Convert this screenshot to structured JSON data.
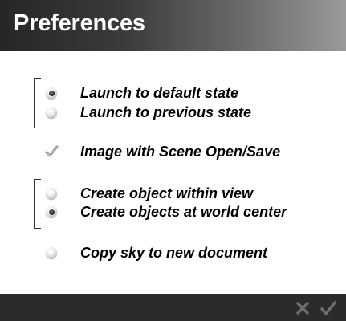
{
  "header": {
    "title": "Preferences"
  },
  "launch_group": {
    "options": [
      {
        "label": "Launch to default state",
        "selected": true
      },
      {
        "label": "Launch to previous state",
        "selected": false
      }
    ]
  },
  "image_scene": {
    "label": "Image with Scene Open/Save",
    "checked": true
  },
  "create_group": {
    "options": [
      {
        "label": "Create object within view",
        "selected": false
      },
      {
        "label": "Create objects at world center",
        "selected": true
      }
    ]
  },
  "copy_sky": {
    "label": "Copy sky to new document",
    "selected": false
  },
  "footer": {
    "cancel_icon": "x-icon",
    "confirm_icon": "checkmark-icon"
  },
  "colors": {
    "header_dark": "#262626",
    "header_light": "#9a9a9a",
    "footer_bg": "#2b2b2b",
    "footer_icon": "#6e6e6e"
  }
}
